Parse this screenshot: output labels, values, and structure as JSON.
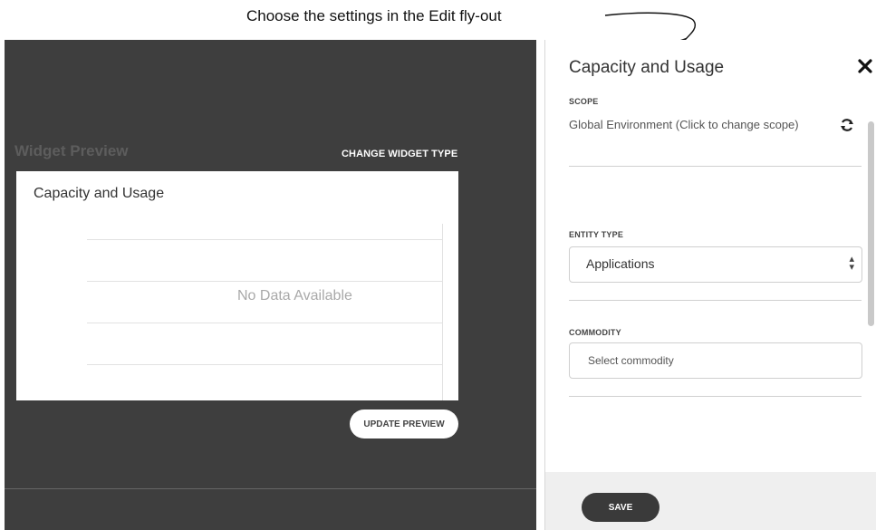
{
  "annotation": {
    "text": "Choose the settings in the Edit fly-out"
  },
  "preview": {
    "title": "Widget Preview",
    "change_type_label": "CHANGE WIDGET TYPE",
    "card_title": "Capacity and Usage",
    "no_data": "No Data Available",
    "update_label": "UPDATE PREVIEW"
  },
  "flyout": {
    "title": "Capacity and Usage",
    "close_icon": "close-icon",
    "scope": {
      "label": "SCOPE",
      "value": "Global Environment (Click to change scope)",
      "icon": "refresh-icon"
    },
    "entity_type": {
      "label": "ENTITY TYPE",
      "selected": "Applications"
    },
    "commodity": {
      "label": "COMMODITY",
      "placeholder": "Select commodity"
    },
    "save_label": "SAVE"
  },
  "colors": {
    "dark_panel": "#3e3e3e",
    "save_button": "#3a3a3a",
    "footer": "#efefef"
  }
}
